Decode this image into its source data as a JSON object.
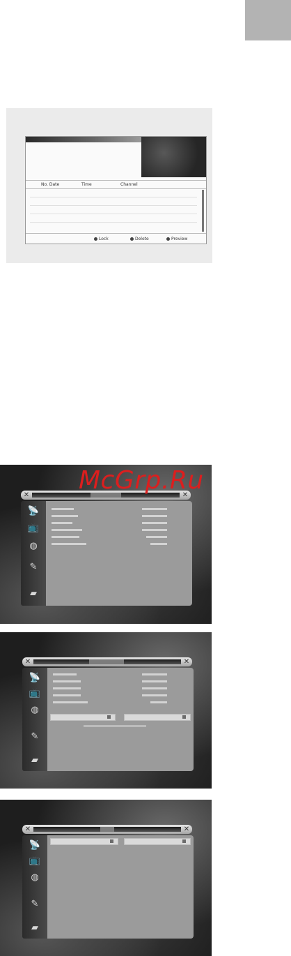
{
  "page": {
    "watermark_text": "McGrp.Ru",
    "accent_color": "#dc1e1e"
  },
  "screens": [
    {
      "id": "screen-1",
      "theme": "light",
      "window": "table list window",
      "columns": [
        "No. Date",
        "Time",
        "Channel"
      ],
      "footer_keys": [
        "Lock",
        "Delete",
        "Preview"
      ]
    },
    {
      "id": "screen-2",
      "theme": "dark",
      "window": "information list",
      "info_row_count": 6,
      "sidebar_icons": [
        "satellite-icon",
        "tv-icon",
        "globe-icon",
        "tools-icon",
        "media-icon"
      ]
    },
    {
      "id": "screen-3",
      "theme": "dark",
      "window": "information list with field bar",
      "info_row_count": 5,
      "field_count": 2
    },
    {
      "id": "screen-4",
      "theme": "dark",
      "window": "single selector row",
      "field_count": 2
    }
  ]
}
